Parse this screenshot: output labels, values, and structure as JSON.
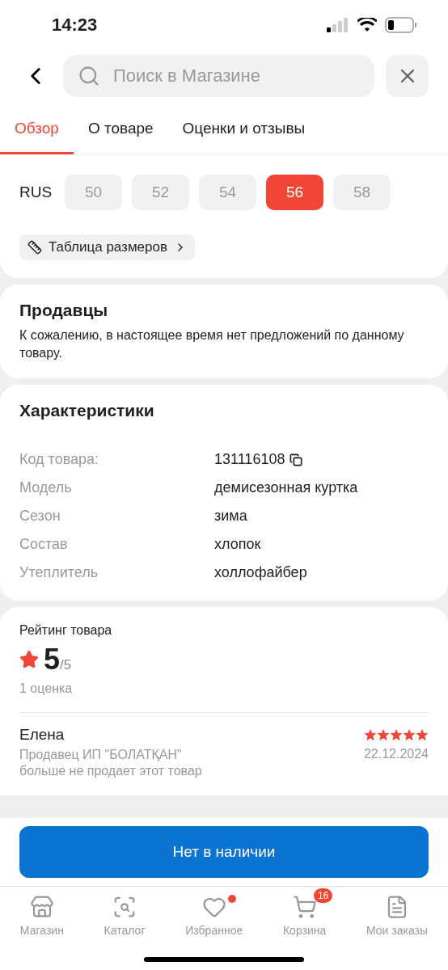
{
  "status_bar": {
    "time": "14:23"
  },
  "search": {
    "placeholder": "Поиск в Магазине"
  },
  "tabs": [
    {
      "label": "Обзор",
      "selected": true
    },
    {
      "label": "О товаре",
      "selected": false
    },
    {
      "label": "Оценки и отзывы",
      "selected": false
    }
  ],
  "sizes": {
    "label": "RUS",
    "options": [
      {
        "label": "50",
        "selected": false
      },
      {
        "label": "52",
        "selected": false
      },
      {
        "label": "54",
        "selected": false
      },
      {
        "label": "56",
        "selected": true
      },
      {
        "label": "58",
        "selected": false
      }
    ],
    "size_table": "Таблица размеров"
  },
  "sellers": {
    "title": "Продавцы",
    "text": "К сожалению, в настоящее время нет предложений по данному товару."
  },
  "specs": {
    "title": "Характеристики",
    "rows": [
      {
        "name": "Код товара:",
        "value": "131116108",
        "copyable": true
      },
      {
        "name": "Модель",
        "value": "демисезонная куртка",
        "copyable": false
      },
      {
        "name": "Сезон",
        "value": "зима",
        "copyable": false
      },
      {
        "name": "Состав",
        "value": "хлопок",
        "copyable": false
      },
      {
        "name": "Утеплитель",
        "value": "холлофайбер",
        "copyable": false
      }
    ]
  },
  "rating": {
    "title": "Рейтинг товара",
    "score": "5",
    "out_of": "/5",
    "count": "1 оценка",
    "reviews": [
      {
        "author": "Елена",
        "stars": 5,
        "date": "22.12.2024",
        "text": "Продавец ИП \"БОЛАТҚАН\" больше не продает этот товар"
      }
    ]
  },
  "action_button": "Нет в наличии",
  "nav": [
    {
      "label": "Магазин",
      "dot": false
    },
    {
      "label": "Каталог",
      "dot": false
    },
    {
      "label": "Избранное",
      "dot": true
    },
    {
      "label": "Корзина",
      "badge": "16",
      "dot": false
    },
    {
      "label": "Мои заказы",
      "dot": false
    }
  ]
}
